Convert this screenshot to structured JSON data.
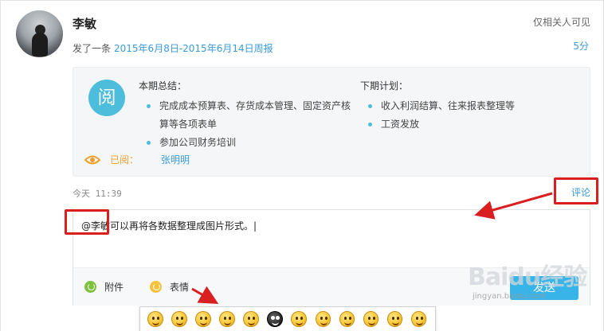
{
  "post": {
    "author": "李敏",
    "visibility": "仅相关人可见",
    "action_text": "发了一条",
    "report_link": "2015年6月8日-2015年6月14日周报",
    "age": "5分"
  },
  "report": {
    "badge": "阅",
    "summary_title": "本期总结：",
    "summary_items": [
      "完成成本预算表、存货成本管理、固定资产核算等各项表单",
      "参加公司财务培训"
    ],
    "plan_title": "下期计划：",
    "plan_items": [
      "收入利润结算、往来报表整理等",
      "工资发放"
    ],
    "read_label": "已阅：",
    "reader": "张明明"
  },
  "meta": {
    "timestamp": "今天 11:39",
    "comment_link": "评论"
  },
  "comment": {
    "mention": "@李敏",
    "text": "可以再将各数据整理成图片形式。|",
    "attach_label": "附件",
    "emoji_label": "表情",
    "submit_label": "发送"
  },
  "emoji_panel": {
    "faces": [
      "smile",
      "grin",
      "laugh",
      "think",
      "wink",
      "dark",
      "hug",
      "angry",
      "shy",
      "dizzy",
      "tongue",
      "happy"
    ]
  },
  "watermark": {
    "brand": "Baidu经验",
    "url": "jingyan.baidu.com"
  },
  "colors": {
    "link": "#3a9bd9",
    "badge": "#4cbddb",
    "read_label": "#f0a02a",
    "annotation": "#d91f1f",
    "submit": "#39b4e8"
  }
}
